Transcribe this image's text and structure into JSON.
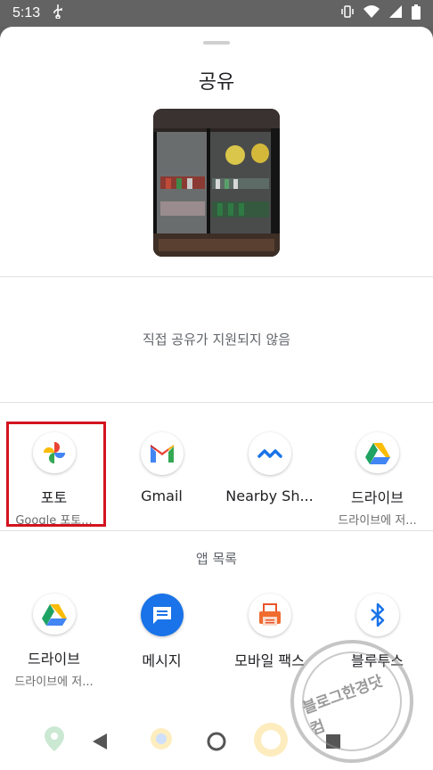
{
  "status_bar": {
    "time": "5:13",
    "usb_icon": "usb-icon",
    "right_icons": [
      "vibrate-icon",
      "wifi-icon",
      "signal-icon",
      "battery-icon"
    ]
  },
  "sheet": {
    "title": "공유",
    "no_direct_share": "직접 공유가 지원되지 않음",
    "section_title": "앱 목록"
  },
  "suggested_apps": [
    {
      "label": "포토",
      "sublabel": "Google 포토...",
      "icon": "google-photos-icon"
    },
    {
      "label": "Gmail",
      "sublabel": "",
      "icon": "gmail-icon"
    },
    {
      "label": "Nearby Sh...",
      "sublabel": "",
      "icon": "nearby-share-icon"
    },
    {
      "label": "드라이브",
      "sublabel": "드라이브에 저...",
      "icon": "google-drive-icon"
    }
  ],
  "all_apps": [
    {
      "label": "드라이브",
      "sublabel": "드라이브에 저...",
      "icon": "google-drive-icon"
    },
    {
      "label": "메시지",
      "sublabel": "",
      "icon": "messages-icon"
    },
    {
      "label": "모바일 팩스",
      "sublabel": "",
      "icon": "fax-icon"
    },
    {
      "label": "블루투스",
      "sublabel": "",
      "icon": "bluetooth-icon"
    }
  ],
  "watermark": {
    "text": "블로그한경닷컴"
  },
  "colors": {
    "highlight": "#d3131f",
    "status_bar": "#636363"
  }
}
